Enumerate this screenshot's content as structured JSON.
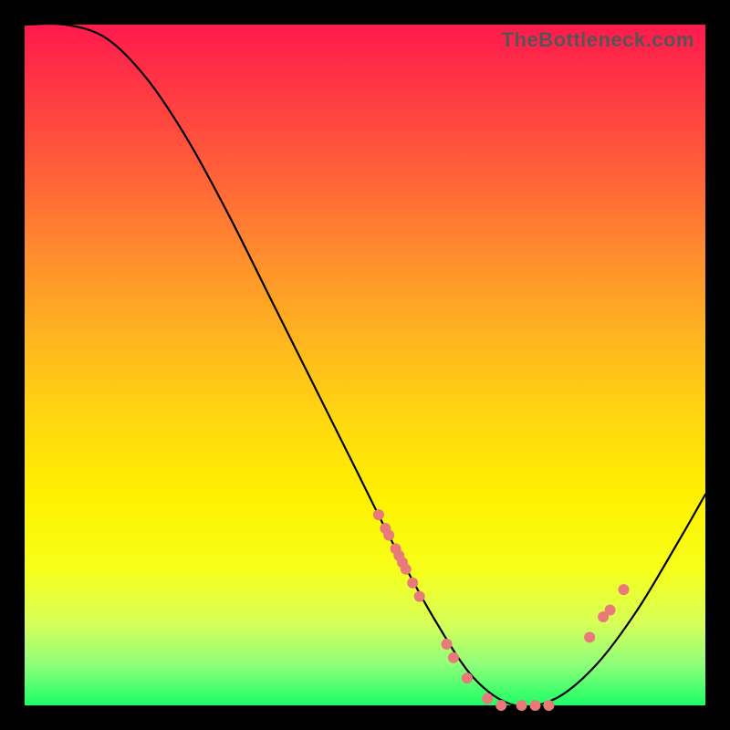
{
  "watermark": "TheBottleneck.com",
  "colors": {
    "dot": "#e87a7a",
    "curve": "#000000",
    "background_border": "#000000"
  },
  "chart_data": {
    "type": "line",
    "title": "",
    "xlabel": "",
    "ylabel": "",
    "xlim": [
      0,
      100
    ],
    "ylim": [
      0,
      100
    ],
    "grid": false,
    "series": [
      {
        "name": "bottleneck-curve",
        "x": [
          0,
          6,
          12,
          18,
          24,
          30,
          36,
          42,
          48,
          54,
          60,
          66,
          72,
          78,
          84,
          90,
          96,
          100
        ],
        "values": [
          100,
          100,
          98,
          92,
          83,
          72,
          60,
          48,
          36,
          24,
          13,
          4,
          0,
          1,
          6,
          14,
          24,
          31
        ]
      }
    ],
    "markers": {
      "name": "highlighted-points",
      "x": [
        52,
        53,
        53.5,
        54.5,
        55,
        55.5,
        56,
        57,
        58,
        62,
        63,
        65,
        68,
        70,
        73,
        75,
        77,
        83,
        85,
        86,
        88
      ],
      "values": [
        28,
        26,
        25,
        23,
        22,
        21,
        20,
        18,
        16,
        9,
        7,
        4,
        1,
        0,
        0,
        0,
        0,
        10,
        13,
        14,
        17
      ]
    }
  }
}
